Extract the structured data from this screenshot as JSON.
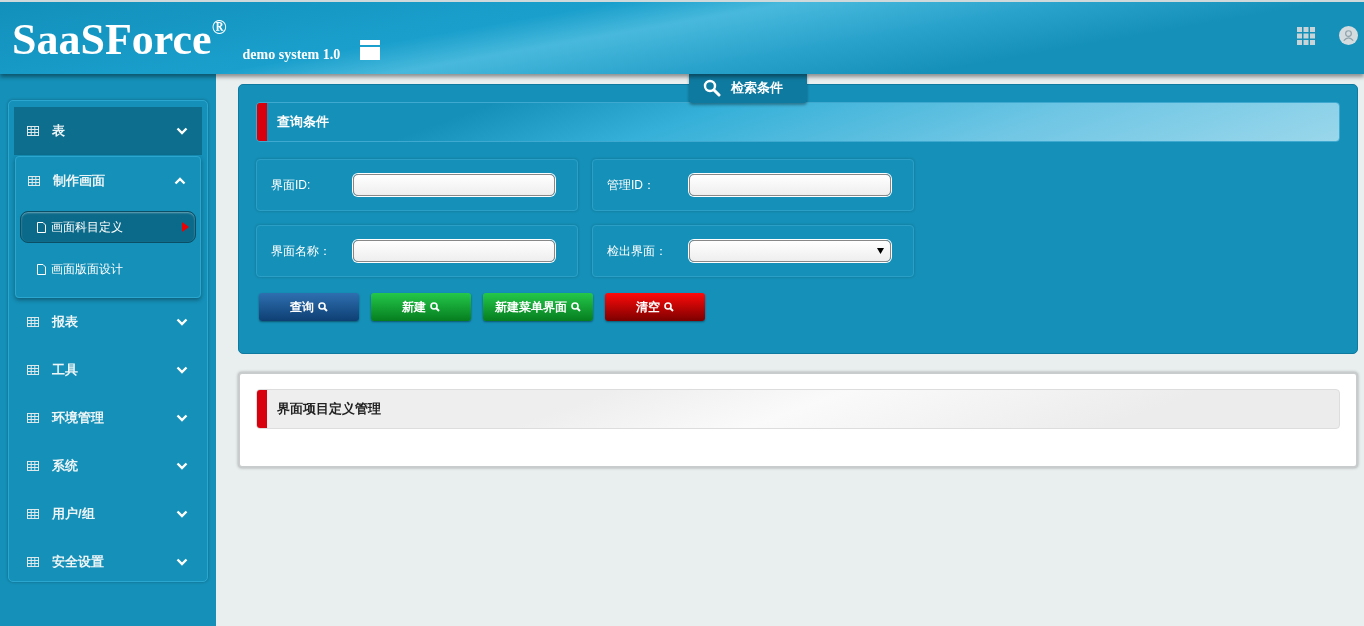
{
  "header": {
    "logo": "SaaSForce$^{®}$",
    "subtitle": "demo system 1.0"
  },
  "sidebar": {
    "items": [
      {
        "label": "表",
        "selected": true,
        "expanded": false
      },
      {
        "label": "制作画面",
        "selected": false,
        "expanded": true,
        "children": [
          {
            "label": "画面科目定义",
            "selected": true
          },
          {
            "label": "画面版面设计",
            "selected": false
          }
        ]
      },
      {
        "label": "报表",
        "selected": false,
        "expanded": false
      },
      {
        "label": "工具",
        "selected": false,
        "expanded": false
      },
      {
        "label": "环境管理",
        "selected": false,
        "expanded": false
      },
      {
        "label": "系统",
        "selected": false,
        "expanded": false
      },
      {
        "label": "用户/组",
        "selected": false,
        "expanded": false
      },
      {
        "label": "安全设置",
        "selected": false,
        "expanded": false
      }
    ]
  },
  "search_panel": {
    "tab": "检索条件",
    "title": "查询条件",
    "fields": [
      {
        "label": "界面ID:",
        "kind": "text"
      },
      {
        "label": "管理ID：",
        "kind": "text"
      },
      {
        "label": "界面名称：",
        "kind": "text"
      },
      {
        "label": "检出界面：",
        "kind": "select"
      }
    ],
    "buttons": [
      {
        "label": "查询",
        "kind": "primary"
      },
      {
        "label": "新建",
        "kind": "success"
      },
      {
        "label": "新建菜单界面",
        "kind": "success"
      },
      {
        "label": "清空",
        "kind": "danger"
      }
    ]
  },
  "list_panel": {
    "title": "界面项目定义管理"
  }
}
